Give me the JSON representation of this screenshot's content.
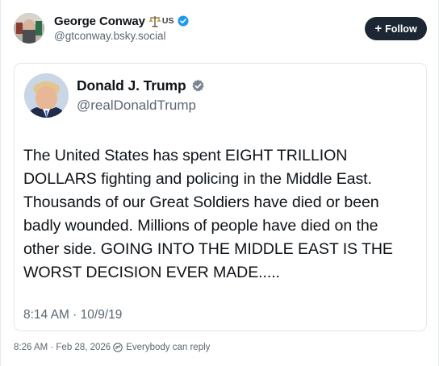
{
  "post": {
    "author_name": "George Conway",
    "author_flair": "US",
    "author_handle": "@gtconway.bsky.social",
    "follow_label": "Follow",
    "timestamp": "8:26 AM · Feb 28, 2026",
    "reply_setting": "Everybody can reply"
  },
  "embed": {
    "author_name": "Donald J. Trump",
    "author_handle": "@realDonaldTrump",
    "text_lines": [
      "The United States has spent EIGHT TRILLION",
      "DOLLARS fighting and policing in the Middle East.",
      "Thousands of our Great Soldiers have died or been",
      "badly wounded. Millions of people have died on the",
      "other side. GOING INTO THE MIDDLE EAST IS THE",
      "WORST DECISION EVER MADE....."
    ],
    "timestamp": "8:14 AM · 10/9/19"
  },
  "icons": {
    "verified": "verified-badge-icon",
    "flair": "scales-of-justice-icon",
    "reply": "reply-setting-icon",
    "follow": "plus-icon"
  },
  "colors": {
    "verified_blue": "#1d9bf0",
    "follow_bg": "#1c2733",
    "muted_text": "#5b6773"
  }
}
